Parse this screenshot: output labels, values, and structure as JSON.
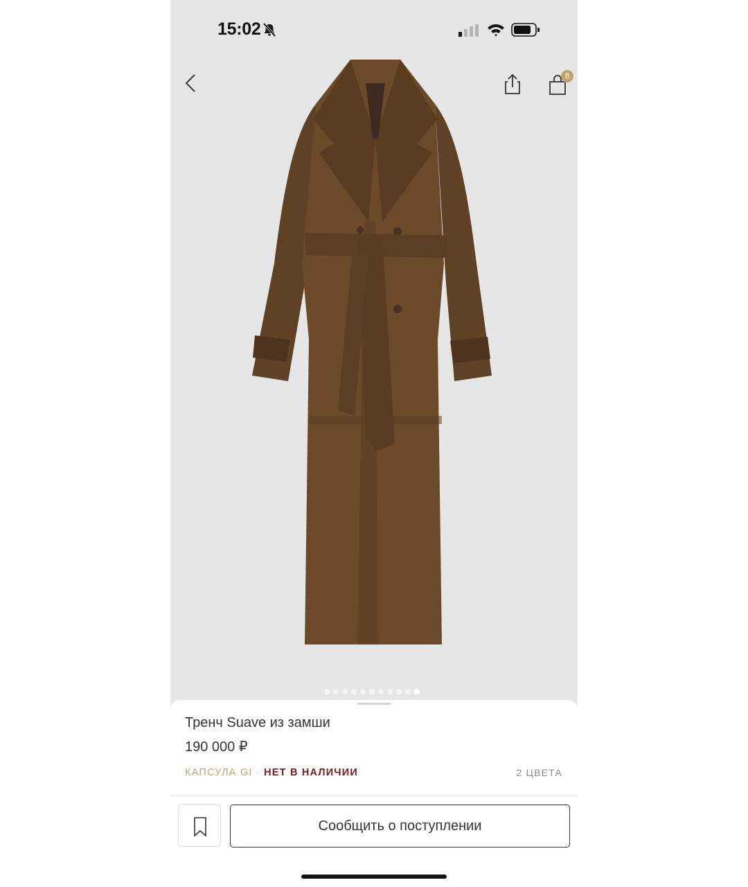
{
  "status_bar": {
    "time": "15:02",
    "icons": [
      "bell-slash-icon",
      "cellular-signal-icon",
      "wifi-icon",
      "battery-icon"
    ]
  },
  "nav": {
    "icons": [
      "back-chevron-icon",
      "share-icon",
      "shopping-bag-icon"
    ],
    "cart_count": "8"
  },
  "gallery": {
    "image_count": 11,
    "active_index": 10
  },
  "product": {
    "title": "Тренч Suave из замши",
    "price": "190 000 ₽",
    "capsule": "КАПСУЛА GI",
    "separator": "·",
    "availability": "НЕТ В НАЛИЧИИ",
    "colors": "2 ЦВЕТА"
  },
  "actions": {
    "bookmark_icon": "bookmark-icon",
    "notify_label": "Сообщить о поступлении"
  },
  "colors": {
    "hero_bg": "#e6e6e6",
    "accent_gold": "#c1a36c",
    "unavailable_red": "#7a1a20",
    "coat_brown": "#6b4a2a"
  }
}
